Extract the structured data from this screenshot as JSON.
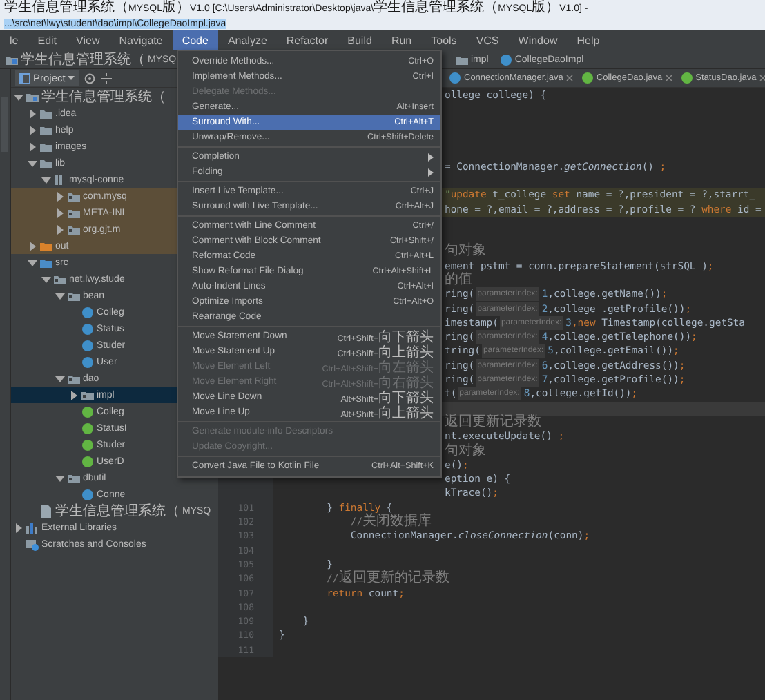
{
  "window": {
    "title": "学生信息管理系统（MYSQL版）V1.0 [C:\\Users\\Administrator\\Desktop\\java\\学生信息管理系统（MYSQL版）V1.0] -",
    "path": "...\\src\\net\\lwy\\student\\dao\\impl\\CollegeDaoImpl.java"
  },
  "menubar": [
    {
      "label": "le",
      "selected": false
    },
    {
      "label": "Edit",
      "selected": false
    },
    {
      "label": "View",
      "selected": false
    },
    {
      "label": "Navigate",
      "selected": false
    },
    {
      "label": "Code",
      "selected": true
    },
    {
      "label": "Analyze",
      "selected": false
    },
    {
      "label": "Refactor",
      "selected": false
    },
    {
      "label": "Build",
      "selected": false
    },
    {
      "label": "Run",
      "selected": false
    },
    {
      "label": "Tools",
      "selected": false
    },
    {
      "label": "VCS",
      "selected": false
    },
    {
      "label": "Window",
      "selected": false
    },
    {
      "label": "Help",
      "selected": false
    }
  ],
  "navbar": [
    {
      "kind": "module",
      "label": "学生信息管理系统（MYSQ"
    },
    {
      "kind": "folder",
      "label": "impl"
    },
    {
      "kind": "class",
      "label": "CollegeDaoImpl"
    }
  ],
  "project": {
    "title": "Project",
    "tree": [
      {
        "label": "学生信息管理系统（",
        "kind": "module",
        "expanded": true,
        "selected": false,
        "shaded": false,
        "children": [
          {
            "label": ".idea",
            "kind": "folder",
            "expanded": false,
            "selected": false,
            "shaded": false
          },
          {
            "label": "help",
            "kind": "folder",
            "expanded": false,
            "selected": false,
            "shaded": false
          },
          {
            "label": "images",
            "kind": "folder",
            "expanded": false,
            "selected": false,
            "shaded": false
          },
          {
            "label": "lib",
            "kind": "folder",
            "expanded": true,
            "selected": false,
            "shaded": false,
            "children": [
              {
                "label": "mysql-conne",
                "kind": "jar",
                "expanded": true,
                "selected": false,
                "shaded": false,
                "children": [
                  {
                    "label": "com.mysq",
                    "kind": "package",
                    "expanded": false,
                    "selected": false,
                    "shaded": true
                  },
                  {
                    "label": "META-INI",
                    "kind": "package",
                    "expanded": false,
                    "selected": false,
                    "shaded": true
                  },
                  {
                    "label": "org.gjt.m",
                    "kind": "package",
                    "expanded": false,
                    "selected": false,
                    "shaded": true
                  }
                ]
              }
            ]
          },
          {
            "label": "out",
            "kind": "excluded",
            "expanded": false,
            "selected": false,
            "shaded": true
          },
          {
            "label": "src",
            "kind": "source",
            "expanded": true,
            "selected": false,
            "shaded": false,
            "children": [
              {
                "label": "net.lwy.stude",
                "kind": "package",
                "expanded": true,
                "selected": false,
                "shaded": false,
                "children": [
                  {
                    "label": "bean",
                    "kind": "package",
                    "expanded": true,
                    "selected": false,
                    "shaded": false,
                    "children": [
                      {
                        "label": "Colleg",
                        "kind": "class",
                        "selected": false,
                        "shaded": false
                      },
                      {
                        "label": "Status",
                        "kind": "class",
                        "selected": false,
                        "shaded": false
                      },
                      {
                        "label": "Studer",
                        "kind": "class",
                        "selected": false,
                        "shaded": false
                      },
                      {
                        "label": "User",
                        "kind": "class",
                        "selected": false,
                        "shaded": false
                      }
                    ]
                  },
                  {
                    "label": "dao",
                    "kind": "package",
                    "expanded": true,
                    "selected": false,
                    "shaded": false,
                    "children": [
                      {
                        "label": "impl",
                        "kind": "package",
                        "expanded": false,
                        "selected": true,
                        "shaded": false
                      },
                      {
                        "label": "Colleg",
                        "kind": "interface",
                        "selected": false,
                        "shaded": false
                      },
                      {
                        "label": "StatusI",
                        "kind": "interface",
                        "selected": false,
                        "shaded": false
                      },
                      {
                        "label": "Studer",
                        "kind": "interface",
                        "selected": false,
                        "shaded": false
                      },
                      {
                        "label": "UserD",
                        "kind": "interface",
                        "selected": false,
                        "shaded": false
                      }
                    ]
                  },
                  {
                    "label": "dbutil",
                    "kind": "package",
                    "expanded": true,
                    "selected": false,
                    "shaded": false,
                    "children": [
                      {
                        "label": "Conne",
                        "kind": "class",
                        "selected": false,
                        "shaded": false
                      }
                    ]
                  }
                ]
              }
            ]
          },
          {
            "label": "学生信息管理系统（MYSQ",
            "kind": "iml",
            "selected": false,
            "shaded": false
          }
        ]
      },
      {
        "label": "External Libraries",
        "kind": "libraries",
        "expanded": false,
        "selected": false,
        "shaded": false
      },
      {
        "label": "Scratches and Consoles",
        "kind": "scratches",
        "selected": false,
        "shaded": false
      }
    ]
  },
  "editor": {
    "tabs": [
      {
        "label": "ConnectionManager.java",
        "kind": "class"
      },
      {
        "label": "CollegeDao.java",
        "kind": "interface"
      },
      {
        "label": "StatusDao.java",
        "kind": "interface"
      }
    ],
    "lines": [
      {
        "kind": "clipped",
        "injected": false,
        "current": false,
        "tokens": [
          {
            "kind": "plain",
            "text": "ollege college) {"
          }
        ]
      },
      {
        "kind": "clipped",
        "injected": false,
        "current": false
      },
      {
        "kind": "clipped",
        "injected": false,
        "current": false
      },
      {
        "kind": "clipped",
        "injected": false,
        "current": false
      },
      {
        "kind": "clipped",
        "injected": false,
        "current": false
      },
      {
        "kind": "clipped",
        "injected": false,
        "current": false,
        "tokens": [
          {
            "kind": "plain",
            "text": "= ConnectionManager."
          },
          {
            "kind": "static",
            "text": "getConnection"
          },
          {
            "kind": "plain",
            "text": "() "
          },
          {
            "kind": "keyword",
            "text": ";"
          }
        ]
      },
      {
        "kind": "clipped",
        "injected": false,
        "current": false
      },
      {
        "kind": "clipped",
        "injected": true,
        "current": false,
        "tokens": [
          {
            "kind": "string",
            "text": "\""
          },
          {
            "kind": "keyword",
            "text": "update"
          },
          {
            "kind": "plain",
            "text": " t_college "
          },
          {
            "kind": "keyword",
            "text": "set"
          },
          {
            "kind": "plain",
            "text": " name = ?,president = ?,starrt_"
          }
        ]
      },
      {
        "kind": "clipped",
        "injected": true,
        "current": false,
        "tokens": [
          {
            "kind": "plain",
            "text": "hone = ?,email = ?,address = ?,profile = ? "
          },
          {
            "kind": "keyword",
            "text": "where"
          },
          {
            "kind": "plain",
            "text": " id ="
          }
        ]
      },
      {
        "kind": "clipped",
        "injected": false,
        "current": false
      },
      {
        "kind": "clipped",
        "injected": false,
        "current": false
      },
      {
        "kind": "clipped",
        "injected": false,
        "current": false,
        "tokens": [
          {
            "kind": "comment",
            "text": "句对象"
          }
        ]
      },
      {
        "kind": "clipped",
        "injected": false,
        "current": false,
        "tokens": [
          {
            "kind": "plain",
            "text": "ement pstmt = conn.prepareStatement(strSQL )"
          },
          {
            "kind": "keyword",
            "text": ";"
          }
        ]
      },
      {
        "kind": "clipped",
        "injected": false,
        "current": false,
        "tokens": [
          {
            "kind": "comment",
            "text": "的值"
          }
        ]
      },
      {
        "kind": "clipped",
        "injected": false,
        "current": false,
        "tokens": [
          {
            "kind": "plain",
            "text": "ring("
          },
          {
            "kind": "hint",
            "text": "parameterIndex:"
          },
          {
            "kind": "number",
            "text": "1"
          },
          {
            "kind": "plain",
            "text": ",college.getName())"
          },
          {
            "kind": "keyword",
            "text": ";"
          }
        ]
      },
      {
        "kind": "clipped",
        "injected": false,
        "current": false,
        "tokens": [
          {
            "kind": "plain",
            "text": "ring("
          },
          {
            "kind": "hint",
            "text": "parameterIndex:"
          },
          {
            "kind": "number",
            "text": "2"
          },
          {
            "kind": "plain",
            "text": ",college .getProfile())"
          },
          {
            "kind": "keyword",
            "text": ";"
          }
        ]
      },
      {
        "kind": "clipped",
        "injected": false,
        "current": false,
        "tokens": [
          {
            "kind": "plain",
            "text": "imestamp("
          },
          {
            "kind": "hint",
            "text": "parameterIndex:"
          },
          {
            "kind": "number",
            "text": "3"
          },
          {
            "kind": "keyword",
            "text": ",new"
          },
          {
            "kind": "plain",
            "text": " Timestamp(college.getSta"
          }
        ]
      },
      {
        "kind": "clipped",
        "injected": false,
        "current": false,
        "tokens": [
          {
            "kind": "plain",
            "text": "ring("
          },
          {
            "kind": "hint",
            "text": "parameterIndex:"
          },
          {
            "kind": "number",
            "text": "4"
          },
          {
            "kind": "plain",
            "text": ",college.getTelephone())"
          },
          {
            "kind": "keyword",
            "text": ";"
          }
        ]
      },
      {
        "kind": "clipped",
        "injected": false,
        "current": false,
        "tokens": [
          {
            "kind": "plain",
            "text": "tring("
          },
          {
            "kind": "hint",
            "text": "parameterIndex:"
          },
          {
            "kind": "number",
            "text": "5"
          },
          {
            "kind": "plain",
            "text": ",college.getEmail())"
          },
          {
            "kind": "keyword",
            "text": ";"
          }
        ]
      },
      {
        "kind": "clipped",
        "injected": false,
        "current": false,
        "tokens": [
          {
            "kind": "plain",
            "text": "ring("
          },
          {
            "kind": "hint",
            "text": "parameterIndex:"
          },
          {
            "kind": "number",
            "text": "6"
          },
          {
            "kind": "plain",
            "text": ",college.getAddress())"
          },
          {
            "kind": "keyword",
            "text": ";"
          }
        ]
      },
      {
        "kind": "clipped",
        "injected": false,
        "current": false,
        "tokens": [
          {
            "kind": "plain",
            "text": "ring("
          },
          {
            "kind": "hint",
            "text": "parameterIndex:"
          },
          {
            "kind": "number",
            "text": "7"
          },
          {
            "kind": "plain",
            "text": ",college.getProfile())"
          },
          {
            "kind": "keyword",
            "text": ";"
          }
        ]
      },
      {
        "kind": "clipped",
        "injected": false,
        "current": false,
        "tokens": [
          {
            "kind": "plain",
            "text": "t("
          },
          {
            "kind": "hint",
            "text": "parameterIndex:"
          },
          {
            "kind": "number",
            "text": "8"
          },
          {
            "kind": "plain",
            "text": ",college.getId())"
          },
          {
            "kind": "keyword",
            "text": ";"
          }
        ]
      },
      {
        "kind": "clipped",
        "injected": false,
        "current": true
      },
      {
        "kind": "clipped",
        "injected": false,
        "current": false,
        "tokens": [
          {
            "kind": "comment",
            "text": "返回更新记录数"
          }
        ]
      },
      {
        "kind": "clipped",
        "injected": false,
        "current": false,
        "tokens": [
          {
            "kind": "plain",
            "text": "nt.executeUpdate() "
          },
          {
            "kind": "keyword",
            "text": ";"
          }
        ]
      },
      {
        "kind": "clipped",
        "injected": false,
        "current": false,
        "tokens": [
          {
            "kind": "comment",
            "text": "句对象"
          }
        ]
      },
      {
        "kind": "clipped",
        "injected": false,
        "current": false,
        "tokens": [
          {
            "kind": "plain",
            "text": "e()"
          },
          {
            "kind": "keyword",
            "text": ";"
          }
        ]
      },
      {
        "kind": "clipped",
        "injected": false,
        "current": false,
        "tokens": [
          {
            "kind": "plain",
            "text": "eption e) {"
          }
        ]
      },
      {
        "kind": "clipped",
        "injected": false,
        "current": false,
        "tokens": [
          {
            "kind": "plain",
            "text": "kTrace()"
          },
          {
            "kind": "keyword",
            "text": ";"
          }
        ]
      },
      {
        "kind": "full",
        "number": "101",
        "injected": false,
        "current": false,
        "tokens": [
          {
            "kind": "plain",
            "text": "        } "
          },
          {
            "kind": "keyword",
            "text": "finally"
          },
          {
            "kind": "plain",
            "text": " {"
          }
        ]
      },
      {
        "kind": "full",
        "number": "102",
        "injected": false,
        "current": false,
        "tokens": [
          {
            "kind": "comment",
            "text": "            //关闭数据库"
          }
        ]
      },
      {
        "kind": "full",
        "number": "103",
        "injected": false,
        "current": false,
        "tokens": [
          {
            "kind": "plain",
            "text": "            ConnectionManager."
          },
          {
            "kind": "static",
            "text": "closeConnection"
          },
          {
            "kind": "plain",
            "text": "(conn)"
          },
          {
            "kind": "keyword",
            "text": ";"
          }
        ]
      },
      {
        "kind": "full",
        "number": "104",
        "injected": false,
        "current": false
      },
      {
        "kind": "full",
        "number": "105",
        "injected": false,
        "current": false,
        "tokens": [
          {
            "kind": "plain",
            "text": "        }"
          }
        ]
      },
      {
        "kind": "full",
        "number": "106",
        "injected": false,
        "current": false,
        "tokens": [
          {
            "kind": "comment",
            "text": "        //返回更新的记录数"
          }
        ]
      },
      {
        "kind": "full",
        "number": "107",
        "injected": false,
        "current": false,
        "tokens": [
          {
            "kind": "keyword",
            "text": "        return"
          },
          {
            "kind": "plain",
            "text": " count"
          },
          {
            "kind": "keyword",
            "text": ";"
          }
        ]
      },
      {
        "kind": "full",
        "number": "108",
        "injected": false,
        "current": false
      },
      {
        "kind": "full",
        "number": "109",
        "injected": false,
        "current": false,
        "tokens": [
          {
            "kind": "plain",
            "text": "    }"
          }
        ]
      },
      {
        "kind": "full",
        "number": "110",
        "injected": false,
        "current": false,
        "tokens": [
          {
            "kind": "plain",
            "text": "}"
          }
        ]
      },
      {
        "kind": "full",
        "number": "111",
        "injected": false,
        "current": false
      }
    ]
  },
  "menu": {
    "items": [
      {
        "kind": "item",
        "label": "Override Methods...",
        "shortcut": "Ctrl+O",
        "disabled": false,
        "selected": false
      },
      {
        "kind": "item",
        "label": "Implement Methods...",
        "shortcut": "Ctrl+I",
        "disabled": false,
        "selected": false
      },
      {
        "kind": "item",
        "label": "Delegate Methods...",
        "disabled": true,
        "selected": false
      },
      {
        "kind": "item",
        "label": "Generate...",
        "shortcut": "Alt+Insert",
        "disabled": false,
        "selected": false
      },
      {
        "kind": "item",
        "label": "Surround With...",
        "shortcut": "Ctrl+Alt+T",
        "disabled": false,
        "selected": true
      },
      {
        "kind": "item",
        "label": "Unwrap/Remove...",
        "shortcut": "Ctrl+Shift+Delete",
        "disabled": false,
        "selected": false
      },
      {
        "kind": "separator"
      },
      {
        "kind": "submenu",
        "label": "Completion",
        "disabled": false,
        "selected": false
      },
      {
        "kind": "submenu",
        "label": "Folding",
        "disabled": false,
        "selected": false
      },
      {
        "kind": "separator"
      },
      {
        "kind": "item",
        "label": "Insert Live Template...",
        "shortcut": "Ctrl+J",
        "disabled": false,
        "selected": false
      },
      {
        "kind": "item",
        "label": "Surround with Live Template...",
        "shortcut": "Ctrl+Alt+J",
        "disabled": false,
        "selected": false
      },
      {
        "kind": "separator"
      },
      {
        "kind": "item",
        "label": "Comment with Line Comment",
        "shortcut": "Ctrl+/",
        "disabled": false,
        "selected": false
      },
      {
        "kind": "item",
        "label": "Comment with Block Comment",
        "shortcut": "Ctrl+Shift+/",
        "disabled": false,
        "selected": false
      },
      {
        "kind": "item",
        "label": "Reformat Code",
        "shortcut": "Ctrl+Alt+L",
        "disabled": false,
        "selected": false
      },
      {
        "kind": "item",
        "label": "Show Reformat File Dialog",
        "shortcut": "Ctrl+Alt+Shift+L",
        "disabled": false,
        "selected": false
      },
      {
        "kind": "item",
        "label": "Auto-Indent Lines",
        "shortcut": "Ctrl+Alt+I",
        "disabled": false,
        "selected": false
      },
      {
        "kind": "item",
        "label": "Optimize Imports",
        "shortcut": "Ctrl+Alt+O",
        "disabled": false,
        "selected": false
      },
      {
        "kind": "item",
        "label": "Rearrange Code",
        "disabled": false,
        "selected": false
      },
      {
        "kind": "separator"
      },
      {
        "kind": "item",
        "label": "Move Statement Down",
        "shortcut": "Ctrl+Shift+向下箭头",
        "disabled": false,
        "selected": false
      },
      {
        "kind": "item",
        "label": "Move Statement Up",
        "shortcut": "Ctrl+Shift+向上箭头",
        "disabled": false,
        "selected": false
      },
      {
        "kind": "item",
        "label": "Move Element Left",
        "shortcut": "Ctrl+Alt+Shift+向左箭头",
        "disabled": true,
        "selected": false
      },
      {
        "kind": "item",
        "label": "Move Element Right",
        "shortcut": "Ctrl+Alt+Shift+向右箭头",
        "disabled": true,
        "selected": false
      },
      {
        "kind": "item",
        "label": "Move Line Down",
        "shortcut": "Alt+Shift+向下箭头",
        "disabled": false,
        "selected": false
      },
      {
        "kind": "item",
        "label": "Move Line Up",
        "shortcut": "Alt+Shift+向上箭头",
        "disabled": false,
        "selected": false
      },
      {
        "kind": "separator"
      },
      {
        "kind": "item",
        "label": "Generate module-info Descriptors",
        "disabled": true,
        "selected": false
      },
      {
        "kind": "item",
        "label": "Update Copyright...",
        "disabled": true,
        "selected": false
      },
      {
        "kind": "separator"
      },
      {
        "kind": "item",
        "label": "Convert Java File to Kotlin File",
        "shortcut": "Ctrl+Alt+Shift+K",
        "disabled": false,
        "selected": false
      }
    ]
  }
}
